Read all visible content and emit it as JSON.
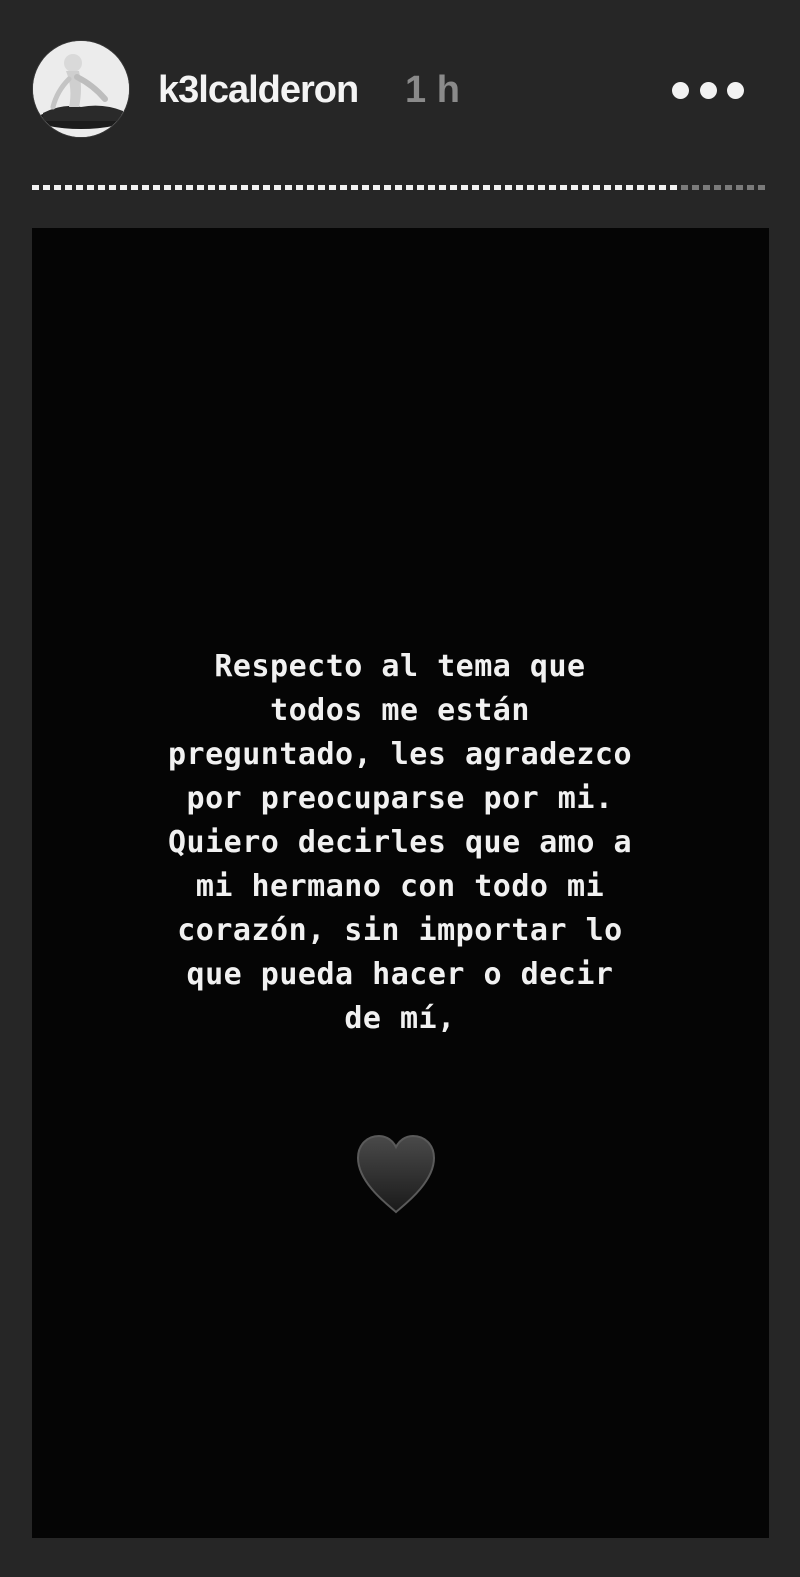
{
  "header": {
    "username": "k3lcalderon",
    "timestamp": "1 h",
    "more_icon": "more-horizontal-icon",
    "avatar": "profile-avatar"
  },
  "progress": {
    "segments": 1,
    "fraction": 0.88
  },
  "story": {
    "text": "Respecto al tema que\ntodos me están\npreguntado, les agradezco\npor preocuparse por mi.\nQuiero decirles que amo a\nmi hermano con todo mi\ncorazón, sin importar lo\nque pueda hacer o decir\nde mí,",
    "emoji": "black-heart-icon",
    "background_color": "#050505",
    "text_color": "#f1f1f1"
  }
}
